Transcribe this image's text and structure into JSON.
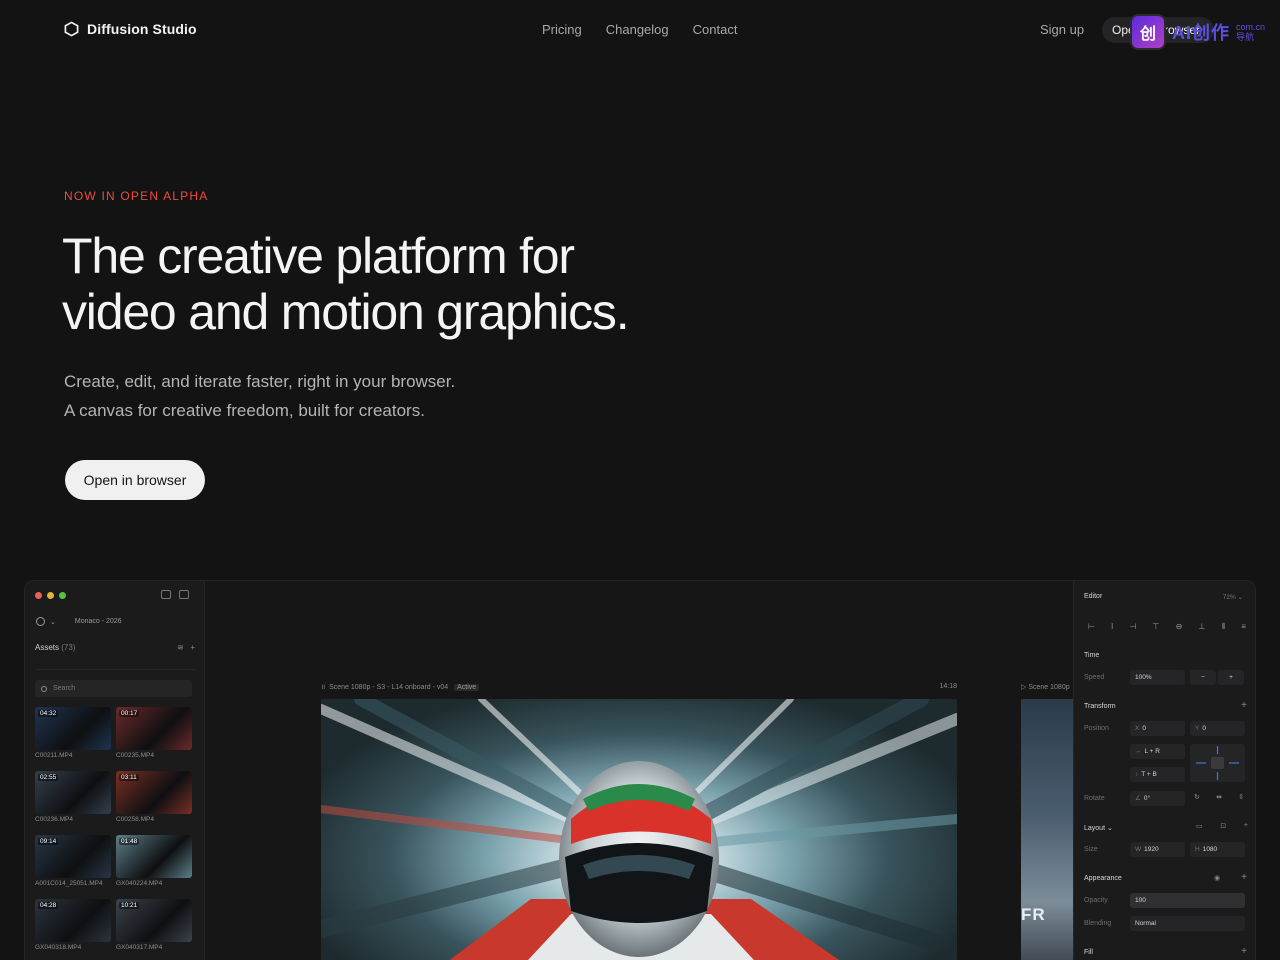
{
  "nav": {
    "brand": "Diffusion Studio",
    "links": [
      "Pricing",
      "Changelog",
      "Contact"
    ],
    "signup": "Sign up",
    "cta": "Open in browser"
  },
  "watermark": {
    "badge": "创",
    "text": "AI创作",
    "small_top": "com.cn",
    "small_bottom": "导航"
  },
  "hero": {
    "eyebrow": "NOW IN OPEN ALPHA",
    "headline_1": "The creative platform for",
    "headline_2": "video and motion graphics.",
    "sub_1": "Create, edit, and iterate faster, right in your browser.",
    "sub_2": "A canvas for creative freedom, built for creators.",
    "cta": "Open in browser"
  },
  "app": {
    "project": "Monaco - 2026",
    "assets_label": "Assets",
    "assets_count": "(73)",
    "search_placeholder": "Search",
    "assets": [
      {
        "dur": "04:32",
        "name": "C00211.MP4",
        "tone": "#1f3450"
      },
      {
        "dur": "00:17",
        "name": "C00235.MP4",
        "tone": "#6b2a2a"
      },
      {
        "dur": "02:55",
        "name": "C00236.MP4",
        "tone": "#34404d"
      },
      {
        "dur": "03:11",
        "name": "C00258.MP4",
        "tone": "#7a2f26"
      },
      {
        "dur": "09:14",
        "name": "A001C014_25051.MP4",
        "tone": "#283646"
      },
      {
        "dur": "01:48",
        "name": "GX040224.MP4",
        "tone": "#5b7f88"
      },
      {
        "dur": "04:28",
        "name": "GX040318.MP4",
        "tone": "#2c3440"
      },
      {
        "dur": "10:21",
        "name": "GX040317.MP4",
        "tone": "#3c434c"
      }
    ],
    "scene_title": "Scene 1080p - S3 - L14 onboard - v04",
    "scene_tag": "Active",
    "scene_time": "14:18",
    "scene2_title": "Scene 1080p",
    "scene2_text": "FR",
    "inspector": {
      "title": "Editor",
      "zoom": "72%",
      "time_label": "Time",
      "speed_label": "Speed",
      "speed_value": "100%",
      "transform_label": "Transform",
      "position_label": "Position",
      "pos_x_prefix": "X",
      "pos_x": "0",
      "pos_y_prefix": "Y",
      "pos_y": "0",
      "h_constraint": "L + R",
      "v_constraint": "T + B",
      "rotate_label": "Rotate",
      "rotate_value": "0°",
      "layout_label": "Layout",
      "size_label": "Size",
      "w_prefix": "W",
      "width": "1920",
      "h_prefix": "H",
      "height": "1080",
      "appearance_label": "Appearance",
      "opacity_label": "Opacity",
      "opacity_value": "100",
      "blending_label": "Blending",
      "blending_value": "Normal",
      "fill_label": "Fill"
    }
  },
  "colors": {
    "accent_red": "#ef4a3c",
    "background": "#131314",
    "cta_bg": "#f0f0f0"
  }
}
